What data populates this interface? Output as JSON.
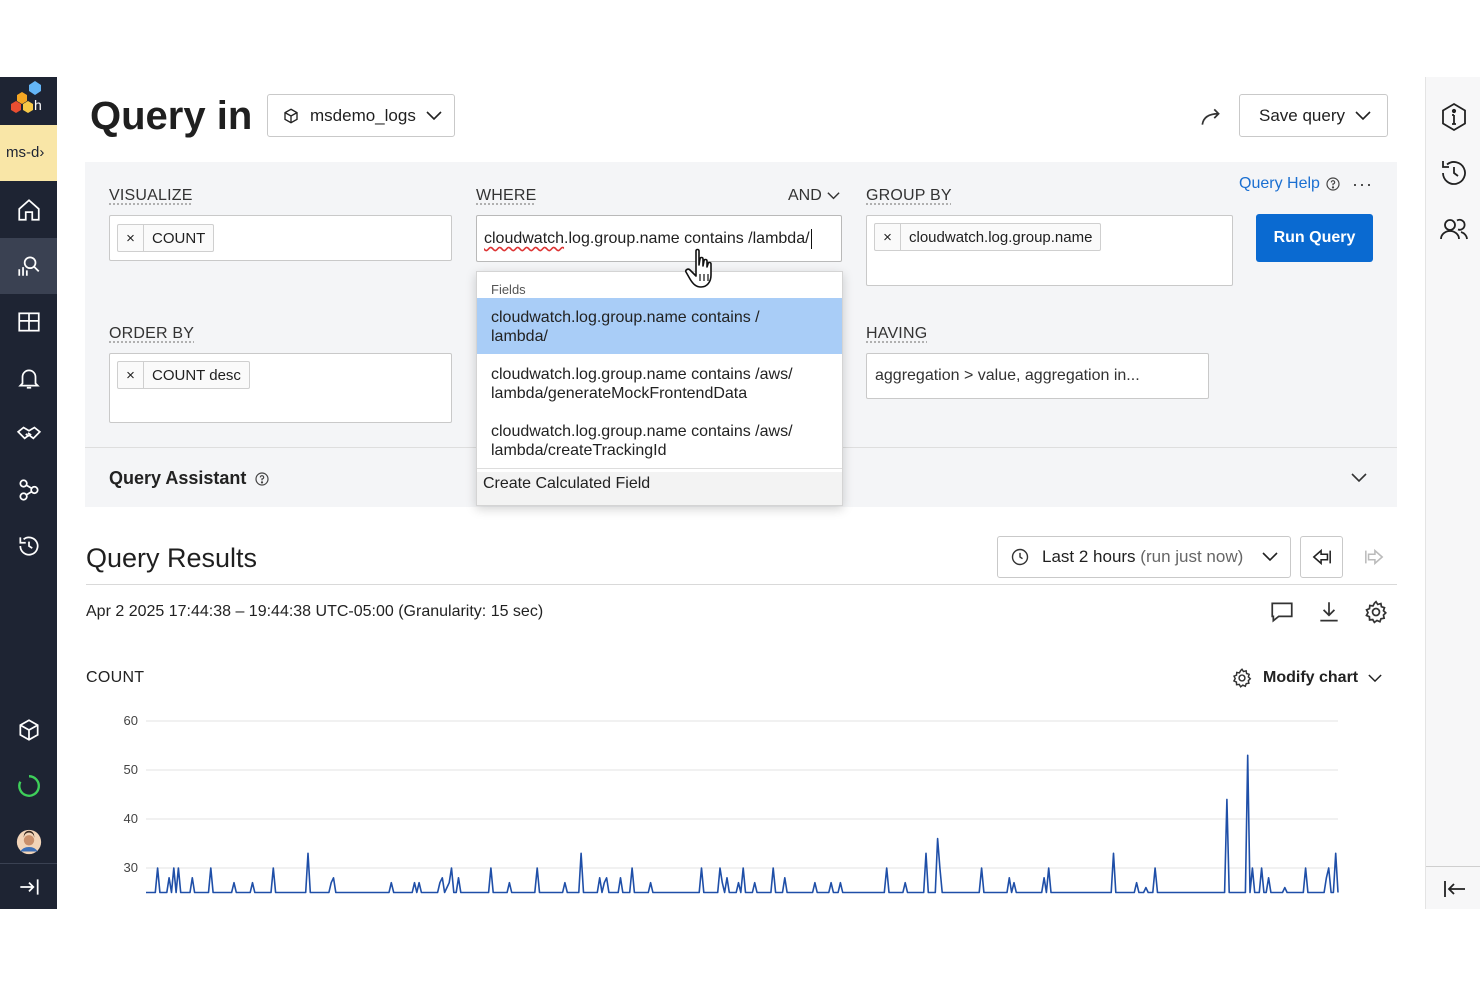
{
  "env": {
    "label": "ms-d",
    "chevron": "›"
  },
  "nav": {
    "items": [
      "home",
      "query",
      "boards",
      "triggers",
      "service-map",
      "relationships",
      "history"
    ],
    "bottom": [
      "datasets",
      "status",
      "profile",
      "expand"
    ]
  },
  "header": {
    "title": "Query in",
    "dataset": "msdemo_logs",
    "save_label": "Save query"
  },
  "builder": {
    "visualize_label": "VISUALIZE",
    "visualize_chip": "COUNT",
    "where_label": "WHERE",
    "where_operator": "AND",
    "where_value_field": "cloudwatch",
    "where_value_rest": ".log.group.name contains /lambda/",
    "group_by_label": "GROUP BY",
    "group_by_chip": "cloudwatch.log.group.name",
    "order_by_label": "ORDER BY",
    "order_by_chip": "COUNT desc",
    "having_label": "HAVING",
    "having_placeholder": "aggregation > value, aggregation in...",
    "query_help": "Query Help",
    "more": "···",
    "run_label": "Run Query",
    "assistant_label": "Query Assistant",
    "chip_remove": "×"
  },
  "dropdown": {
    "header": "Fields",
    "items": [
      {
        "line1": "cloudwatch.log.group.name contains /",
        "line2": "lambda/"
      },
      {
        "line1": "cloudwatch.log.group.name contains /aws/",
        "line2": "lambda/generateMockFrontendData"
      },
      {
        "line1": "cloudwatch.log.group.name contains /aws/",
        "line2": "lambda/createTrackingId"
      }
    ],
    "footer": "Create Calculated Field"
  },
  "results": {
    "title": "Query Results",
    "time_range": "Last 2 hours",
    "time_note": "(run just now)",
    "range_text": "Apr 2 2025 17:44:38 – 19:44:38 UTC-05:00 (Granularity: 15 sec)",
    "count_label": "COUNT",
    "modify_label": "Modify chart"
  },
  "colors": {
    "accent": "#0a6ad1",
    "nav_bg": "#1e2433",
    "env_bg": "#f9e6a7",
    "series": "#1f4fa8",
    "dropdown_selected": "#a9cdf7"
  },
  "chart_data": {
    "type": "line",
    "title": "",
    "ylabel": "COUNT",
    "xlabel": "",
    "ylim": [
      25,
      60
    ],
    "yticks": [
      30,
      40,
      50,
      60
    ],
    "grid": true,
    "series": [
      {
        "name": "",
        "values": [
          25,
          25,
          25,
          25,
          25,
          30,
          25,
          25,
          25,
          25,
          28,
          25,
          30,
          25,
          30,
          25,
          25,
          25,
          25,
          25,
          28,
          25,
          25,
          25,
          25,
          25,
          25,
          25,
          30,
          25,
          25,
          25,
          25,
          25,
          25,
          25,
          25,
          25,
          27,
          25,
          25,
          25,
          25,
          25,
          25,
          25,
          27,
          25,
          25,
          25,
          25,
          25,
          25,
          25,
          25,
          30,
          25,
          25,
          25,
          25,
          25,
          25,
          25,
          25,
          25,
          25,
          25,
          25,
          25,
          25,
          33,
          25,
          25,
          25,
          25,
          25,
          25,
          25,
          25,
          25,
          27,
          28,
          25,
          25,
          25,
          25,
          25,
          25,
          25,
          25,
          25,
          25,
          25,
          25,
          25,
          25,
          25,
          25,
          25,
          25,
          25,
          25,
          25,
          25,
          25,
          25,
          27,
          25,
          25,
          25,
          25,
          25,
          25,
          25,
          25,
          25,
          27,
          25,
          27,
          25,
          25,
          25,
          25,
          25,
          25,
          25,
          25,
          27,
          28,
          25,
          26,
          27,
          30,
          25,
          25,
          28,
          25,
          25,
          25,
          25,
          25,
          25,
          25,
          25,
          25,
          25,
          25,
          25,
          25,
          30,
          25,
          25,
          25,
          25,
          25,
          25,
          25,
          27,
          25,
          25,
          25,
          25,
          25,
          25,
          25,
          25,
          25,
          25,
          25,
          30,
          25,
          25,
          25,
          25,
          25,
          25,
          25,
          25,
          25,
          25,
          25,
          27,
          25,
          25,
          25,
          25,
          25,
          25,
          33,
          25,
          25,
          25,
          25,
          25,
          25,
          25,
          28,
          25,
          27,
          28,
          25,
          25,
          25,
          25,
          25,
          28,
          25,
          25,
          25,
          25,
          30,
          25,
          25,
          25,
          25,
          25,
          25,
          25,
          27,
          25,
          25,
          25,
          25,
          25,
          25,
          25,
          25,
          25,
          25,
          25,
          25,
          25,
          25,
          25,
          25,
          25,
          25,
          25,
          25,
          25,
          30,
          25,
          25,
          25,
          25,
          25,
          25,
          25,
          30,
          27,
          25,
          28,
          25,
          25,
          25,
          25,
          27,
          25,
          30,
          25,
          25,
          25,
          25,
          27,
          25,
          25,
          25,
          25,
          25,
          25,
          25,
          30,
          25,
          25,
          25,
          25,
          28,
          25,
          25,
          25,
          25,
          25,
          25,
          25,
          25,
          25,
          25,
          25,
          25,
          27,
          25,
          25,
          25,
          25,
          25,
          25,
          27,
          25,
          25,
          25,
          27,
          25,
          25,
          25,
          25,
          25,
          25,
          25,
          25,
          25,
          25,
          25,
          25,
          25,
          25,
          25,
          25,
          25,
          25,
          25,
          30,
          25,
          25,
          25,
          25,
          25,
          25,
          25,
          27,
          25,
          25,
          25,
          25,
          25,
          25,
          25,
          25,
          33,
          25,
          25,
          25,
          25,
          36,
          30,
          25,
          25,
          25,
          25,
          25,
          25,
          25,
          25,
          25,
          25,
          25,
          25,
          25,
          25,
          25,
          25,
          25,
          30,
          25,
          25,
          25,
          25,
          25,
          25,
          25,
          25,
          25,
          25,
          25,
          28,
          25,
          27,
          25,
          25,
          25,
          25,
          25,
          25,
          25,
          25,
          25,
          25,
          25,
          25,
          28,
          25,
          30,
          25,
          25,
          25,
          25,
          25,
          25,
          25,
          25,
          25,
          25,
          25,
          25,
          25,
          25,
          25,
          25,
          25,
          25,
          25,
          25,
          25,
          25,
          25,
          25,
          25,
          25,
          25,
          33,
          25,
          25,
          25,
          25,
          25,
          25,
          25,
          25,
          25,
          27,
          25,
          25,
          25,
          26,
          25,
          25,
          25,
          30,
          25,
          25,
          25,
          25,
          25,
          25,
          25,
          25,
          25,
          25,
          25,
          25,
          25,
          25,
          25,
          25,
          25,
          25,
          25,
          25,
          25,
          25,
          25,
          25,
          25,
          25,
          25,
          25,
          25,
          25,
          44,
          25,
          25,
          25,
          25,
          25,
          25,
          25,
          25,
          53,
          25,
          30,
          25,
          25,
          25,
          30,
          25,
          25,
          28,
          25,
          25,
          25,
          25,
          25,
          25,
          26,
          25,
          25,
          25,
          25,
          25,
          25,
          25,
          25,
          30,
          25,
          25,
          25,
          25,
          25,
          25,
          25,
          25,
          28,
          30,
          25,
          25,
          33,
          25
        ]
      }
    ]
  }
}
